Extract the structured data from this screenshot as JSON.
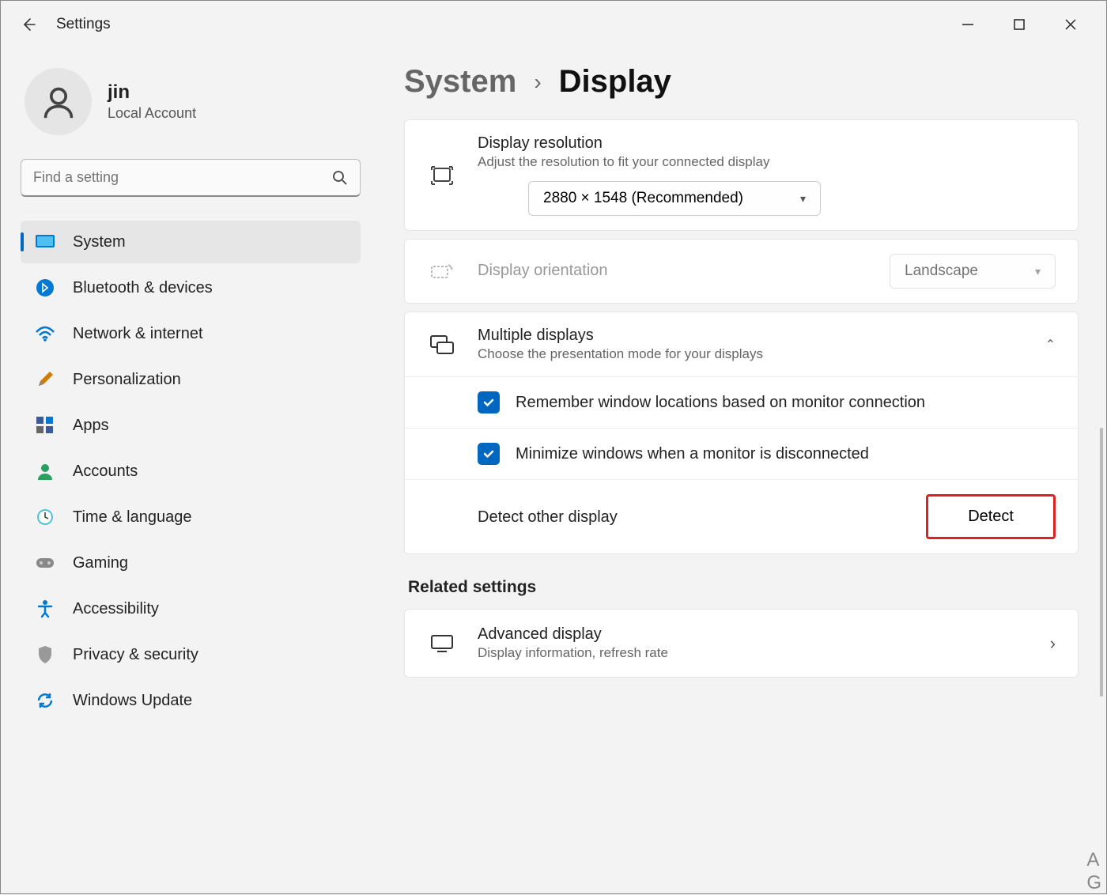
{
  "titlebar": {
    "title": "Settings"
  },
  "profile": {
    "name": "jin",
    "type": "Local Account"
  },
  "search": {
    "placeholder": "Find a setting"
  },
  "nav": {
    "items": [
      {
        "label": "System",
        "icon": "🖥️",
        "active": true
      },
      {
        "label": "Bluetooth & devices",
        "icon": "bt"
      },
      {
        "label": "Network & internet",
        "icon": "wifi"
      },
      {
        "label": "Personalization",
        "icon": "brush"
      },
      {
        "label": "Apps",
        "icon": "apps"
      },
      {
        "label": "Accounts",
        "icon": "person"
      },
      {
        "label": "Time & language",
        "icon": "clock"
      },
      {
        "label": "Gaming",
        "icon": "game"
      },
      {
        "label": "Accessibility",
        "icon": "access"
      },
      {
        "label": "Privacy & security",
        "icon": "shield"
      },
      {
        "label": "Windows Update",
        "icon": "update"
      }
    ]
  },
  "breadcrumb": {
    "parent": "System",
    "current": "Display"
  },
  "resolution": {
    "title": "Display resolution",
    "sub": "Adjust the resolution to fit your connected display",
    "value": "2880 × 1548 (Recommended)"
  },
  "orientation": {
    "title": "Display orientation",
    "value": "Landscape"
  },
  "multi": {
    "title": "Multiple displays",
    "sub": "Choose the presentation mode for your displays",
    "check1": "Remember window locations based on monitor connection",
    "check2": "Minimize windows when a monitor is disconnected",
    "detect_label": "Detect other display",
    "detect_btn": "Detect"
  },
  "related": {
    "heading": "Related settings",
    "advanced_title": "Advanced display",
    "advanced_sub": "Display information, refresh rate"
  }
}
